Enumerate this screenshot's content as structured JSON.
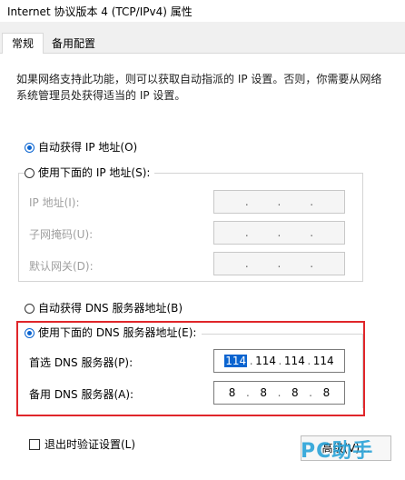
{
  "window": {
    "title": "Internet 协议版本 4 (TCP/IPv4) 属性"
  },
  "tabs": [
    {
      "label": "常规",
      "active": true
    },
    {
      "label": "备用配置",
      "active": false
    }
  ],
  "description": "如果网络支持此功能，则可以获取自动指派的 IP 设置。否则，你需要从网络系统管理员处获得适当的 IP 设置。",
  "ip_section": {
    "auto_label": "自动获得 IP 地址(O)",
    "manual_label": "使用下面的 IP 地址(S):",
    "auto_checked": true,
    "fields": [
      {
        "label": "IP 地址(I):",
        "octets": [
          "",
          "",
          "",
          ""
        ]
      },
      {
        "label": "子网掩码(U):",
        "octets": [
          "",
          "",
          "",
          ""
        ]
      },
      {
        "label": "默认网关(D):",
        "octets": [
          "",
          "",
          "",
          ""
        ]
      }
    ]
  },
  "dns_section": {
    "auto_label": "自动获得 DNS 服务器地址(B)",
    "manual_label": "使用下面的 DNS 服务器地址(E):",
    "manual_checked": true,
    "preferred_label": "首选 DNS 服务器(P):",
    "preferred": [
      "114",
      "114",
      "114",
      "114"
    ],
    "alternate_label": "备用 DNS 服务器(A):",
    "alternate": [
      "8",
      "8",
      "8",
      "8"
    ]
  },
  "validate_label": "退出时验证设置(L)",
  "advanced_button": "高级(V)...",
  "watermark": "PC助手",
  "colors": {
    "accent": "#0a64d0",
    "highlight_frame": "#e0262a"
  }
}
